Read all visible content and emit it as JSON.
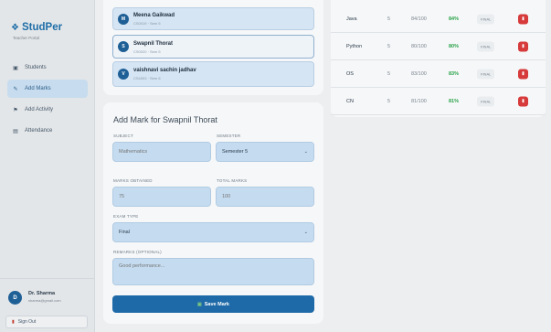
{
  "sidebar": {
    "logo": "StudPer",
    "subtitle": "Teacher Portal",
    "items": [
      {
        "label": "Students",
        "icon": "students-icon"
      },
      {
        "label": "Add Marks",
        "icon": "marks-icon",
        "active": true
      },
      {
        "label": "Add Activity",
        "icon": "activity-icon"
      },
      {
        "label": "Attendance",
        "icon": "attendance-icon"
      }
    ],
    "user": {
      "initial": "D",
      "name": "Dr. Sharma",
      "email": "sharma@gmail.com"
    },
    "signout": "Sign Out"
  },
  "students": [
    {
      "initial": "M",
      "name": "Meena Gaikwad",
      "sub": "CS0019 · Sem 5"
    },
    {
      "initial": "S",
      "name": "Swapnil Thorat",
      "sub": "CS0020 · Sem 5",
      "selected": true
    },
    {
      "initial": "V",
      "name": "vaishnavi sachin jadhav",
      "sub": "CS4003 · Sem 6"
    }
  ],
  "form": {
    "title": "Add Mark for Swapnil Thorat",
    "subject_label": "SUBJECT",
    "subject_placeholder": "Mathematics",
    "semester_label": "SEMESTER",
    "semester_value": "Semester 5",
    "marks_label": "MARKS OBTAINED",
    "marks_placeholder": "75",
    "total_label": "TOTAL MARKS",
    "total_placeholder": "100",
    "exam_label": "EXAM TYPE",
    "exam_value": "Final",
    "remarks_label": "REMARKS (OPTIONAL)",
    "remarks_placeholder": "Good performance...",
    "save_label": "Save Mark"
  },
  "marks": [
    {
      "subject": "Java",
      "sem": "5",
      "marks": "84/100",
      "pct": "84%",
      "type": "FINAL"
    },
    {
      "subject": "Python",
      "sem": "5",
      "marks": "80/100",
      "pct": "80%",
      "type": "FINAL"
    },
    {
      "subject": "OS",
      "sem": "5",
      "marks": "83/100",
      "pct": "83%",
      "type": "FINAL"
    },
    {
      "subject": "CN",
      "sem": "5",
      "marks": "81/100",
      "pct": "81%",
      "type": "FINAL"
    }
  ],
  "colors": {
    "accent": "#1e6aa8",
    "success": "#2aa34a",
    "danger": "#d63a3a"
  }
}
